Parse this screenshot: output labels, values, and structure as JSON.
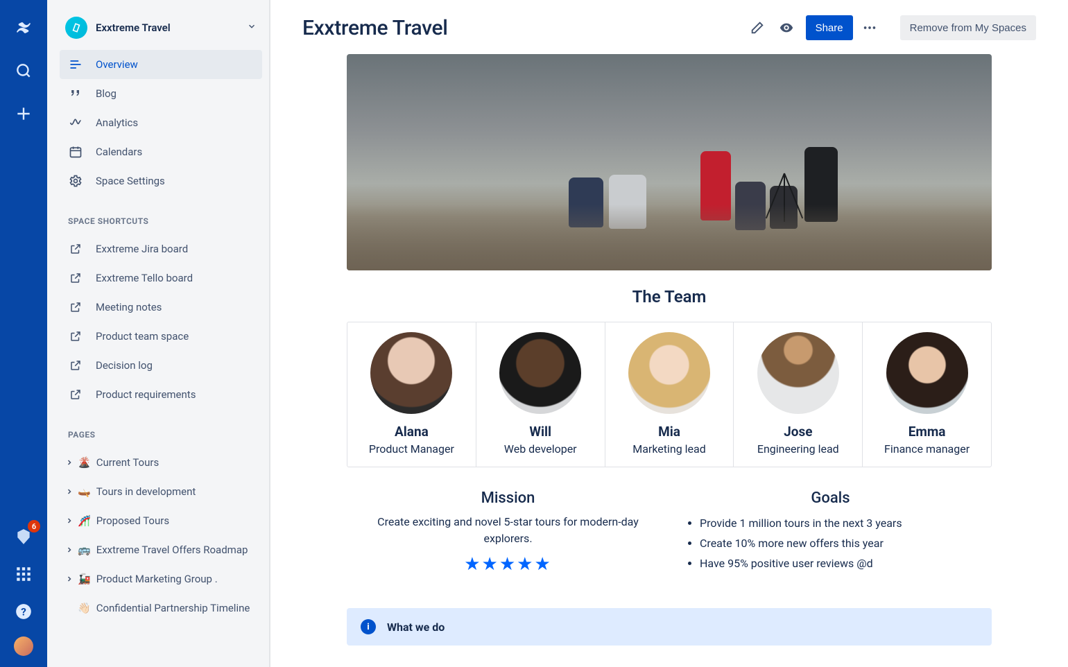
{
  "global_nav": {
    "notification_count": "6"
  },
  "sidebar": {
    "space_name": "Exxtreme Travel",
    "nav": [
      {
        "label": "Overview"
      },
      {
        "label": "Blog"
      },
      {
        "label": "Analytics"
      },
      {
        "label": "Calendars"
      },
      {
        "label": "Space Settings"
      }
    ],
    "shortcuts_heading": "SPACE SHORTCUTS",
    "shortcuts": [
      {
        "label": "Exxtreme Jira board"
      },
      {
        "label": "Exxtreme Tello board"
      },
      {
        "label": "Meeting notes"
      },
      {
        "label": "Product team space"
      },
      {
        "label": "Decision log"
      },
      {
        "label": "Product requirements"
      }
    ],
    "pages_heading": "PAGES",
    "pages": [
      {
        "emoji": "🌋",
        "label": "Current Tours"
      },
      {
        "emoji": "🛶",
        "label": "Tours in development"
      },
      {
        "emoji": "🎢",
        "label": "Proposed Tours"
      },
      {
        "emoji": "🚌",
        "label": "Exxtreme Travel Offers Roadmap"
      },
      {
        "emoji": "🚂",
        "label": "Product Marketing Group ."
      },
      {
        "emoji": "👋🏻",
        "label": "Confidential Partnership Timeline"
      }
    ]
  },
  "header": {
    "title": "Exxtreme Travel",
    "share": "Share",
    "remove": "Remove from My Spaces"
  },
  "content": {
    "team_heading": "The Team",
    "team": [
      {
        "name": "Alana",
        "role": "Product Manager"
      },
      {
        "name": "Will",
        "role": "Web developer"
      },
      {
        "name": "Mia",
        "role": "Marketing lead"
      },
      {
        "name": "Jose",
        "role": "Engineering lead"
      },
      {
        "name": "Emma",
        "role": "Finance manager"
      }
    ],
    "mission_heading": "Mission",
    "mission_text": "Create exciting and novel 5-star tours for modern-day explorers.",
    "goals_heading": "Goals",
    "goals": [
      "Provide 1 million tours in the next 3 years",
      "Create 10% more new offers this year",
      "Have 95% positive user reviews @d"
    ],
    "panel_title": "What we do"
  }
}
